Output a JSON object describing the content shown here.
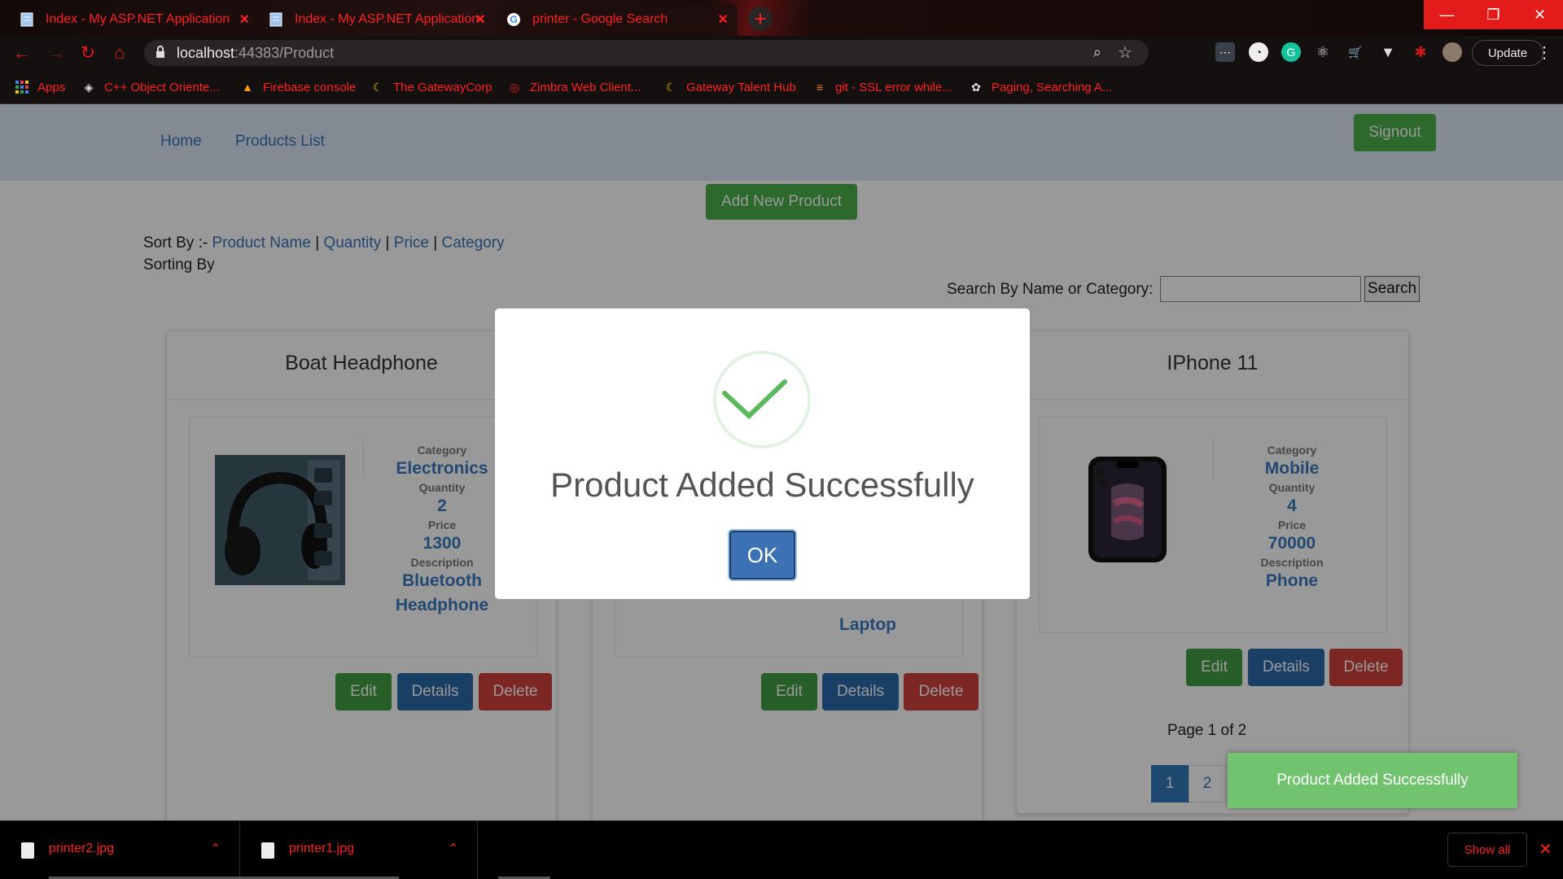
{
  "browser": {
    "tabs": [
      {
        "title": "Index - My ASP.NET Application",
        "icon": "page-icon"
      },
      {
        "title": "Index - My ASP.NET Application",
        "icon": "page-icon"
      },
      {
        "title": "printer - Google Search",
        "icon": "google-icon"
      }
    ],
    "url_host": "localhost",
    "url_rest": ":44383/Product",
    "update_label": "Update",
    "bookmarks": [
      {
        "label": "Apps",
        "icon": "apps-grid-icon"
      },
      {
        "label": "C++ Object Oriente...",
        "icon": "diamond-icon"
      },
      {
        "label": "Firebase console",
        "icon": "firebase-icon"
      },
      {
        "label": "The GatewayCorp",
        "icon": "gateway-icon"
      },
      {
        "label": "Zimbra Web Client...",
        "icon": "zimbra-icon"
      },
      {
        "label": "Gateway Talent Hub",
        "icon": "gateway-icon"
      },
      {
        "label": "git - SSL error while...",
        "icon": "stackoverflow-icon"
      },
      {
        "label": "Paging, Searching A...",
        "icon": "aspnet-icon"
      }
    ]
  },
  "nav": {
    "home": "Home",
    "products_list": "Products List",
    "signout": "Signout"
  },
  "toolbar": {
    "add_new": "Add New Product",
    "sort_prefix": "Sort By :- ",
    "sort_options": [
      "Product Name",
      "Quantity",
      "Price",
      "Category"
    ],
    "sorting_by": "Sorting By",
    "search_label": "Search By Name or Category:",
    "search_value": "",
    "search_button": "Search"
  },
  "labels": {
    "category": "Category",
    "quantity": "Quantity",
    "price": "Price",
    "description": "Description",
    "edit": "Edit",
    "details": "Details",
    "delete": "Delete"
  },
  "products": [
    {
      "name": "Boat Headphone",
      "category": "Electronics",
      "quantity": "2",
      "price": "1300",
      "description_l1": "Bluetooth",
      "description_l2": "Headphone"
    },
    {
      "name": "",
      "description_l2": "Laptop"
    },
    {
      "name": "IPhone 11",
      "category": "Mobile",
      "quantity": "4",
      "price": "70000",
      "description_l1": "Phone"
    }
  ],
  "pagination": {
    "summary": "Page 1 of 2",
    "pages": [
      "1",
      "2"
    ],
    "current": "1"
  },
  "modal": {
    "message": "Product Added Successfully",
    "ok": "OK"
  },
  "toast": {
    "message": "Product Added Successfully"
  },
  "downloads": {
    "items": [
      "printer2.jpg",
      "printer1.jpg"
    ],
    "show_all": "Show all"
  },
  "colors": {
    "success": "#4cae4c",
    "primary": "#2c6aa8",
    "danger": "#d0413c",
    "link": "#3a73b4",
    "chrome_accent": "#ff2020"
  }
}
